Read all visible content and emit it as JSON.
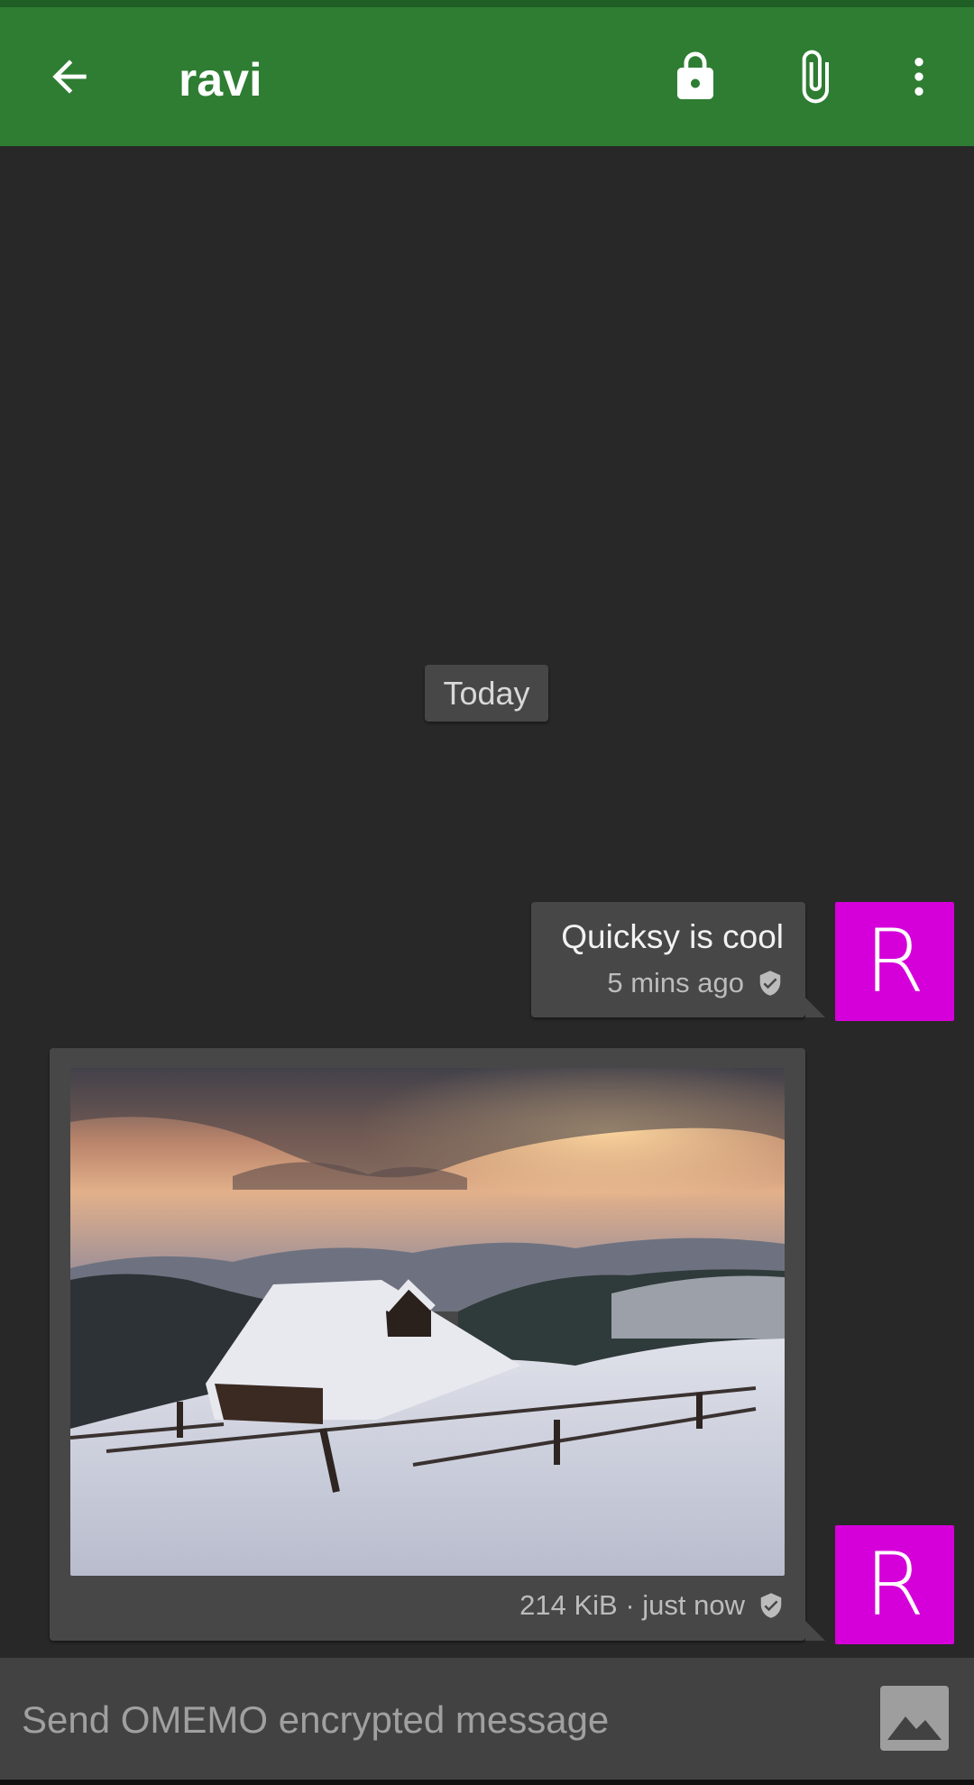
{
  "toolbar": {
    "title": "ravi",
    "back_icon": "arrow-back-icon",
    "lock_icon": "lock-icon",
    "attach_icon": "paperclip-icon",
    "menu_icon": "more-vert-icon"
  },
  "colors": {
    "toolbar": "#2e7d32",
    "background": "#282828",
    "bubble": "#474747",
    "avatar": "#d500d9"
  },
  "date_separator": "Today",
  "messages": [
    {
      "text": "Quicksy is cool",
      "meta": "5 mins ago",
      "avatar_letter": "R",
      "status_icon": "verified-shield-icon"
    },
    {
      "type": "image",
      "image_subject": "snow-covered cabin in mountains at sunset",
      "meta": "214 KiB · just now",
      "avatar_letter": "R",
      "status_icon": "verified-shield-icon"
    }
  ],
  "composer": {
    "placeholder": "Send OMEMO encrypted message",
    "send_icon": "image-icon"
  }
}
